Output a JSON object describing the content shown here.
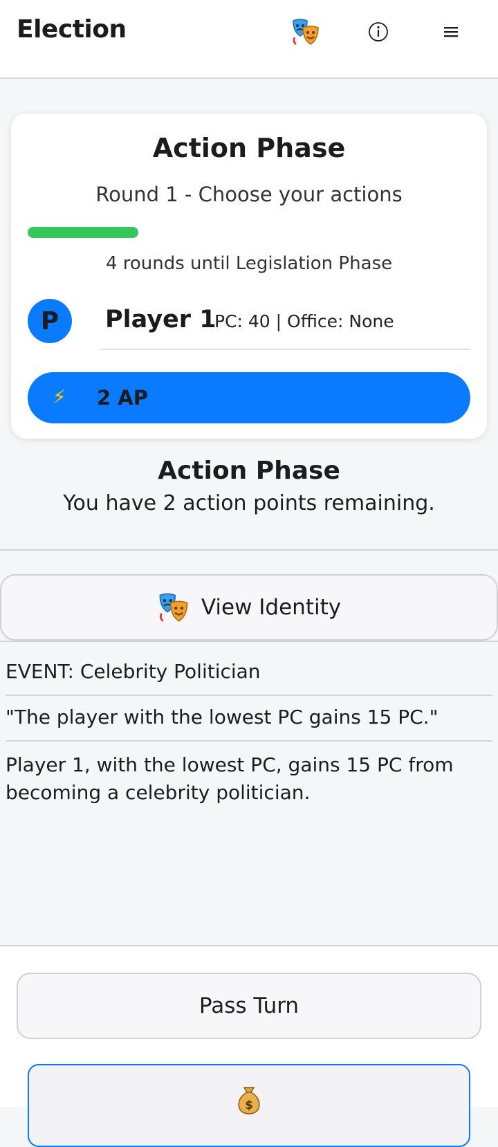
{
  "header": {
    "title": "Election",
    "icons": [
      "theater-masks-icon",
      "info-icon",
      "menu-icon"
    ],
    "info_glyph": "ⓘ",
    "menu_glyph": "≡"
  },
  "status_card": {
    "title": "Action Phase",
    "subtitle": "Round 1 - Choose your actions",
    "progress": 0.25,
    "rounds_text": "4 rounds until Legislation Phase",
    "player": {
      "initial": "P",
      "name": "Player 1",
      "stats": "PC: 40 | Office: None"
    },
    "ap": {
      "icon": "lightning-icon",
      "glyph": "⚡",
      "label": "2 AP"
    }
  },
  "phase": {
    "title": "Action Phase",
    "subtitle": "You have 2 action points remaining."
  },
  "identity_button": {
    "icon": "theater-masks-icon",
    "label": "View Identity"
  },
  "event_log": [
    "EVENT: Celebrity Politician",
    "\"The player with the lowest PC gains 15 PC.\"",
    "Player 1, with the lowest PC, gains 15 PC from becoming a celebrity politician."
  ],
  "actions": {
    "pass_label": "Pass Turn",
    "money_icon": "money-bag-icon"
  },
  "colors": {
    "accent_blue": "#0a7bff",
    "progress_green": "#34c759",
    "background": "#f5f6f8"
  }
}
